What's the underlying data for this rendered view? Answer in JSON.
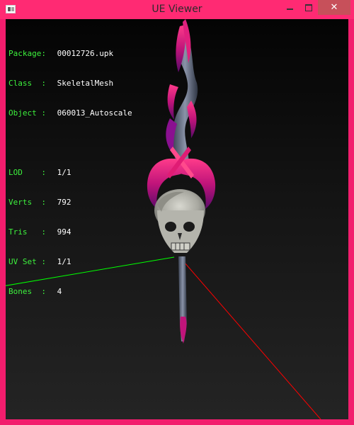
{
  "window": {
    "title": "UE Viewer",
    "icon": "ue-viewer-app-icon",
    "controls": {
      "minimize": "minimize-icon",
      "maximize": "maximize-icon",
      "close": "✕"
    }
  },
  "info": {
    "package": {
      "label": "Package:",
      "value": "00012726.upk"
    },
    "class": {
      "label": "Class  :",
      "value": "SkeletalMesh"
    },
    "object": {
      "label": "Object :",
      "value": "060013_Autoscale"
    },
    "lod": {
      "label": "LOD    :",
      "value": "1/1"
    },
    "verts": {
      "label": "Verts  :",
      "value": "792"
    },
    "tris": {
      "label": "Tris   :",
      "value": "994"
    },
    "uvset": {
      "label": "UV Set :",
      "value": "1/1"
    },
    "bones": {
      "label": "Bones  :",
      "value": "4"
    }
  },
  "colors": {
    "frame": "#f21d6d",
    "label_green": "#3df23d",
    "value_white": "#ffffff",
    "axis_x": "#ff0000",
    "axis_y": "#00ff00",
    "close_button": "#c7505a"
  },
  "scene": {
    "model": "demonic skull staff (skeletal mesh)",
    "axes": [
      "x-axis-red",
      "y-axis-green"
    ]
  }
}
